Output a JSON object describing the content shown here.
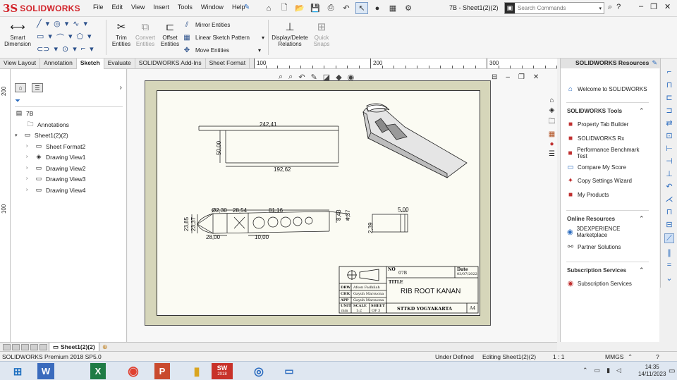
{
  "app": {
    "brand_mark": "3S",
    "brand": "SOLIDWORKS",
    "document_title": "7B - Sheet1(2)(2)"
  },
  "menu": [
    "File",
    "Edit",
    "View",
    "Insert",
    "Tools",
    "Window",
    "Help"
  ],
  "search": {
    "placeholder": "Search Commands"
  },
  "commands": {
    "smart_dimension": "Smart Dimension",
    "trim_entities": "Trim Entities",
    "convert_entities": "Convert Entities",
    "offset_entities": "Offset Entities",
    "mirror_entities": "Mirror Entities",
    "linear_sketch_pattern": "Linear Sketch Pattern",
    "move_entities": "Move Entities",
    "display_delete_relations": "Display/Delete Relations",
    "quick_snaps": "Quick Snaps"
  },
  "tabs": [
    {
      "label": "View Layout",
      "active": false
    },
    {
      "label": "Annotation",
      "active": false
    },
    {
      "label": "Sketch",
      "active": true
    },
    {
      "label": "Evaluate",
      "active": false
    },
    {
      "label": "SOLIDWORKS Add-Ins",
      "active": false
    },
    {
      "label": "Sheet Format",
      "active": false
    }
  ],
  "rulers": {
    "top": [
      "100",
      "200",
      "300"
    ],
    "left": [
      "200",
      "100"
    ]
  },
  "feature_tree": {
    "root": "7B",
    "annotations": "Annotations",
    "sheet": "Sheet1(2)(2)",
    "children": [
      "Sheet Format2",
      "Drawing View1",
      "Drawing View2",
      "Drawing View3",
      "Drawing View4"
    ]
  },
  "drawing": {
    "dims_top": {
      "length": "242,41",
      "height": "50,00",
      "inner": "192,62"
    },
    "dims_section": {
      "hole": "Ø2,30",
      "d1": "28,54",
      "d2": "81,16",
      "h1": "23,85",
      "h2": "23,37",
      "h3": "8,43",
      "h4": "4,37",
      "b1": "28,00",
      "b2": "10,00"
    },
    "dims_side": {
      "w": "5,00",
      "h": "2,39"
    }
  },
  "title_block": {
    "no_label": "NO",
    "no_value": "07B",
    "date_label": "Date",
    "date_value": "03/07/2022",
    "title_label": "TITLE",
    "title_value": "RIB ROOT KANAN",
    "drw_label": "DRW",
    "drw_value": "Afson Fadhilah",
    "chk_label": "CHK",
    "chk_value": "Gayuh Marsuona",
    "app_label": "APP",
    "app_value": "Gayuh Marsuona",
    "unit_label": "UNIT",
    "unit_value": "mm",
    "scale_label": "SCALE",
    "scale_value": "1:2",
    "sheet_label": "SHEET",
    "sheet_value": "OF 3",
    "school": "STTKD YOGYAKARTA",
    "paper": "A4"
  },
  "task_pane": {
    "title": "SOLIDWORKS Resources",
    "welcome": "Welcome to SOLIDWORKS",
    "tools_header": "SOLIDWORKS Tools",
    "tools": [
      "Property Tab Builder",
      "SOLIDWORKS Rx",
      "Performance Benchmark Test",
      "Compare My Score",
      "Copy Settings Wizard",
      "My Products"
    ],
    "online_header": "Online Resources",
    "online": [
      "3DEXPERIENCE Marketplace",
      "Partner Solutions"
    ],
    "subs_header": "Subscription Services",
    "subs": [
      "Subscription Services"
    ]
  },
  "sheet_tab": "Sheet1(2)(2)",
  "status": {
    "product": "SOLIDWORKS Premium 2018 SP5.0",
    "defined": "Under Defined",
    "editing": "Editing Sheet1(2)(2)",
    "scale": "1 : 1",
    "units": "MMGS"
  },
  "taskbar": {
    "sw_label": "2018",
    "time": "14:35",
    "date": "14/11/2023"
  }
}
